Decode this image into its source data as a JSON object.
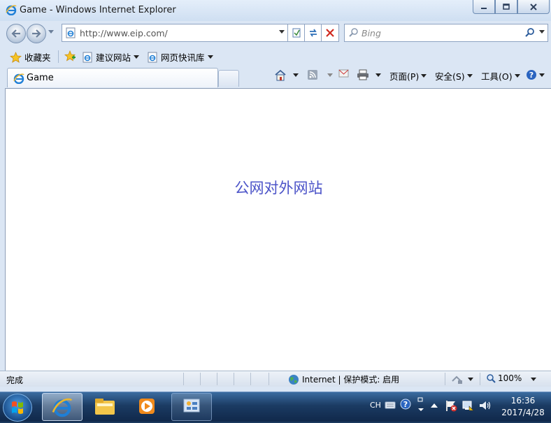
{
  "window": {
    "title": "Game - Windows Internet Explorer"
  },
  "nav": {
    "address": "http://www.eip.com/",
    "search_placeholder": "Bing"
  },
  "favorites_bar": {
    "favorites_label": "收藏夹",
    "items": [
      {
        "label": "建议网站",
        "icon": "ie-page-icon"
      },
      {
        "label": "网页快讯库",
        "icon": "ie-page-icon"
      }
    ]
  },
  "tabs": [
    {
      "label": "Game",
      "icon": "ie-icon"
    }
  ],
  "command_bar": {
    "page": "页面(P)",
    "safety": "安全(S)",
    "tools": "工具(O)"
  },
  "content": {
    "headline": "公网对外网站",
    "headline_color": "#4b53c8"
  },
  "status_bar": {
    "status": "完成",
    "zone": "Internet | 保护模式: 启用",
    "zoom": "100%"
  },
  "taskbar": {
    "language": "CH",
    "time": "16:36",
    "date": "2017/4/28",
    "buttons": [
      "ie-icon",
      "explorer-folder-icon",
      "media-player-icon",
      "network-icon"
    ]
  },
  "colors": {
    "chrome": "#dbe6f4",
    "taskbar": "#1b3b63"
  }
}
